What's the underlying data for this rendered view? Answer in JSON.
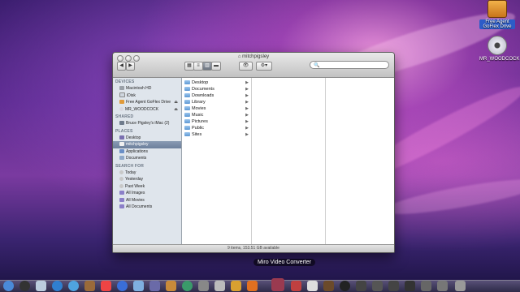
{
  "desktop": {
    "icons": [
      {
        "label": "Free Agent GoFlex Drive",
        "icon": "external-drive-icon",
        "selected": true
      },
      {
        "label": "MR_WOODCOCK",
        "icon": "optical-disc-icon",
        "selected": false
      }
    ]
  },
  "window": {
    "title": "mitchpigsley",
    "search_placeholder": "",
    "nav_back": "◀",
    "nav_forward": "▶",
    "status": "9 items, 153.51 GB available",
    "sidebar": {
      "devices_header": "DEVICES",
      "devices": [
        "Macintosh HD",
        "iDisk",
        "Free Agent GoFlex Drive",
        "MR_WOODCOCK"
      ],
      "shared_header": "SHARED",
      "shared": [
        "Bruce Pigsley's iMac (2)"
      ],
      "places_header": "PLACES",
      "places": [
        "Desktop",
        "mitchpigsley",
        "Applications",
        "Documents"
      ],
      "search_header": "SEARCH FOR",
      "search_for": [
        "Today",
        "Yesterday",
        "Past Week",
        "All Images",
        "All Movies",
        "All Documents"
      ]
    },
    "folders": [
      "Desktop",
      "Documents",
      "Downloads",
      "Library",
      "Movies",
      "Music",
      "Pictures",
      "Public",
      "Sites"
    ]
  },
  "dock": {
    "tooltip": "Miro Video Converter"
  }
}
